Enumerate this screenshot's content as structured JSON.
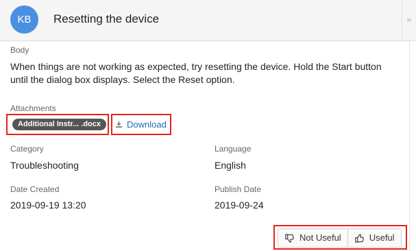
{
  "header": {
    "badge": "KB",
    "title": "Resetting the device",
    "collapse_glyph": "»"
  },
  "body": {
    "label": "Body",
    "text": "When things are not working as expected, try resetting the device. Hold the Start button until the dialog box displays. Select the Reset option."
  },
  "attachments": {
    "label": "Attachments",
    "file_name": "Additional Instr... .docx",
    "download_label": "Download"
  },
  "fields": {
    "category": {
      "label": "Category",
      "value": "Troubleshooting"
    },
    "language": {
      "label": "Language",
      "value": "English"
    },
    "date_created": {
      "label": "Date Created",
      "value": "2019-09-19 13:20"
    },
    "publish_date": {
      "label": "Publish Date",
      "value": "2019-09-24"
    }
  },
  "feedback": {
    "not_useful_label": "Not Useful",
    "useful_label": "Useful"
  },
  "colors": {
    "badge": "#4a90e2",
    "highlight": "#e3231a",
    "link": "#1b6db3",
    "pill": "#555555"
  },
  "icons": {
    "collapse": "double-chevron-right-icon",
    "download": "download-icon",
    "not_useful": "thumbs-down-icon",
    "useful": "thumbs-up-icon"
  }
}
